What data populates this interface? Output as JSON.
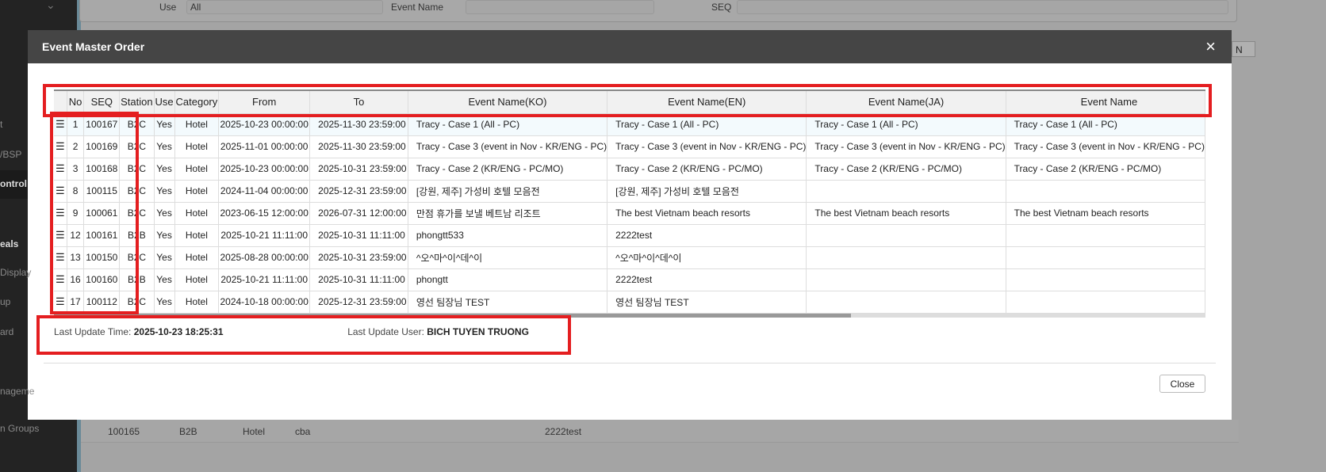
{
  "sidebar": {
    "items": [
      "t",
      "/BSP",
      "ontrol",
      "eals",
      "Display",
      "up",
      "ard",
      "nageme",
      "n Groups"
    ]
  },
  "background": {
    "filters": {
      "use_label": "Use",
      "use_value": "All",
      "event_name_label": "Event Name",
      "seq_label": "SEQ"
    },
    "row": [
      "100165",
      "B2B",
      "Hotel",
      "cba",
      "2222test"
    ],
    "right_button": "N"
  },
  "modal": {
    "title": "Event Master Order",
    "columns": [
      "",
      "No",
      "SEQ",
      "Station",
      "Use",
      "Category",
      "From",
      "To",
      "Event Name(KO)",
      "Event Name(EN)",
      "Event Name(JA)",
      "Event Name"
    ],
    "rows": [
      [
        "1",
        "100167",
        "B2C",
        "Yes",
        "Hotel",
        "2025-10-23 00:00:00",
        "2025-11-30 23:59:00",
        "Tracy - Case 1 (All - PC)",
        "Tracy - Case 1 (All - PC)",
        "Tracy - Case 1 (All - PC)",
        "Tracy - Case 1 (All - PC)"
      ],
      [
        "2",
        "100169",
        "B2C",
        "Yes",
        "Hotel",
        "2025-11-01 00:00:00",
        "2025-11-30 23:59:00",
        "Tracy - Case 3 (event in Nov - KR/ENG - PC)",
        "Tracy - Case 3 (event in Nov - KR/ENG - PC)",
        "Tracy - Case 3 (event in Nov - KR/ENG - PC)",
        "Tracy - Case 3 (event in Nov - KR/ENG - PC)"
      ],
      [
        "3",
        "100168",
        "B2C",
        "Yes",
        "Hotel",
        "2025-10-23 00:00:00",
        "2025-10-31 23:59:00",
        "Tracy - Case 2 (KR/ENG - PC/MO)",
        "Tracy - Case 2 (KR/ENG - PC/MO)",
        "Tracy - Case 2 (KR/ENG - PC/MO)",
        "Tracy - Case 2 (KR/ENG - PC/MO)"
      ],
      [
        "8",
        "100115",
        "B2C",
        "Yes",
        "Hotel",
        "2024-11-04 00:00:00",
        "2025-12-31 23:59:00",
        "[강원, 제주] 가성비 호텔 모음전",
        "[강원, 제주] 가성비 호텔 모음전",
        "",
        ""
      ],
      [
        "9",
        "100061",
        "B2C",
        "Yes",
        "Hotel",
        "2023-06-15 12:00:00",
        "2026-07-31 12:00:00",
        "만점 휴가를 보낼 베트남 리조트",
        "The best Vietnam beach resorts",
        "The best Vietnam beach resorts",
        "The best Vietnam beach resorts"
      ],
      [
        "12",
        "100161",
        "B2B",
        "Yes",
        "Hotel",
        "2025-10-21 11:11:00",
        "2025-10-31 11:11:00",
        "phongtt533",
        "2222test",
        "",
        ""
      ],
      [
        "13",
        "100150",
        "B2C",
        "Yes",
        "Hotel",
        "2025-08-28 00:00:00",
        "2025-10-31 23:59:00",
        "^오^마^이^데^이",
        "^오^마^이^데^이",
        "",
        ""
      ],
      [
        "16",
        "100160",
        "B2B",
        "Yes",
        "Hotel",
        "2025-10-21 11:11:00",
        "2025-10-31 11:11:00",
        "phongtt",
        "2222test",
        "",
        ""
      ],
      [
        "17",
        "100112",
        "B2C",
        "Yes",
        "Hotel",
        "2024-10-18 00:00:00",
        "2025-12-31 23:59:00",
        "영선 팀장님 TEST",
        "영선 팀장님 TEST",
        "",
        ""
      ]
    ],
    "last_update_time_label": "Last Update Time:",
    "last_update_time": "2025-10-23 18:25:31",
    "last_update_user_label": "Last Update User:",
    "last_update_user": "BICH TUYEN TRUONG",
    "close_label": "Close",
    "close_icon": "×",
    "drag_icon": "☰"
  },
  "colors": {
    "annotation": "#e41e20",
    "header": "#454545"
  }
}
